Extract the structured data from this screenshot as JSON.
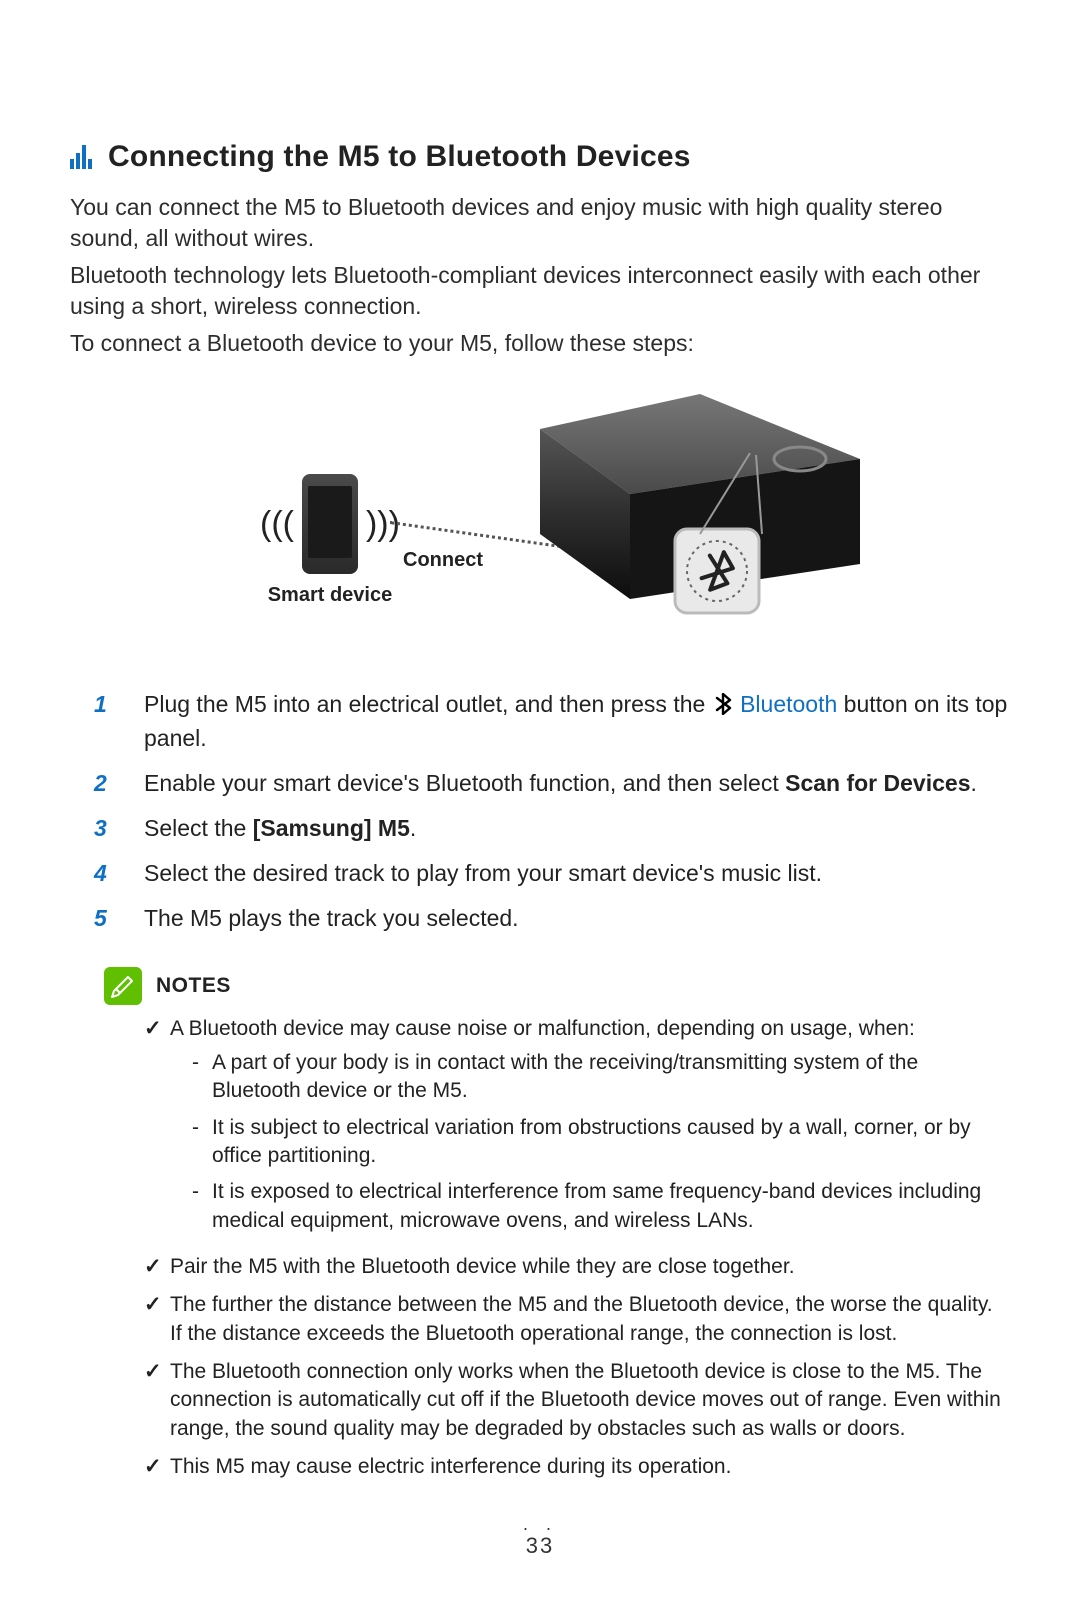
{
  "heading": "Connecting the M5 to Bluetooth Devices",
  "intro": {
    "p1": "You can connect the M5 to Bluetooth devices and enjoy music with high quality stereo sound, all without wires.",
    "p2": "Bluetooth technology lets Bluetooth-compliant devices interconnect easily with each other using a short, wireless connection.",
    "p3": "To connect a Bluetooth device to your M5, follow these steps:"
  },
  "figure": {
    "smart_device_label": "Smart device",
    "connect_label": "Connect",
    "speaker_alt": "M5 speaker with Bluetooth button highlighted"
  },
  "steps": {
    "s1_a": "Plug the M5 into an electrical outlet, and then press the ",
    "s1_bt_word": "Bluetooth",
    "s1_b": " button on its top panel.",
    "s2_a": "Enable your smart device's Bluetooth function, and then select ",
    "s2_bold": "Scan for Devices",
    "s2_b": ".",
    "s3_a": "Select the ",
    "s3_bold": "[Samsung] M5",
    "s3_b": ".",
    "s4": "Select the desired track to play from your smart device's music list.",
    "s5": "The M5 plays the track you selected."
  },
  "notes": {
    "title": "NOTES",
    "n1": "A Bluetooth device may cause noise or malfunction, depending on usage, when:",
    "n1_sub": {
      "a": "A part of your body is in contact with the receiving/transmitting system of the Bluetooth device or the M5.",
      "b": "It is subject to electrical variation from obstructions caused by a wall, corner, or by office partitioning.",
      "c": "It is exposed to electrical interference from same frequency-band devices including medical equipment, microwave ovens, and wireless LANs."
    },
    "n2": "Pair the M5 with the Bluetooth device while they are close together.",
    "n3": "The further the distance between the M5 and the Bluetooth device, the worse the quality. If the distance exceeds the Bluetooth operational range, the connection is lost.",
    "n4": "The Bluetooth connection only works when the Bluetooth device is close to the M5. The connection is automatically cut off if the Bluetooth device moves out of range. Even within range, the sound quality may be degraded by obstacles such as walls or doors.",
    "n5": "This M5 may cause electric interference during its operation."
  },
  "page_number": "33"
}
